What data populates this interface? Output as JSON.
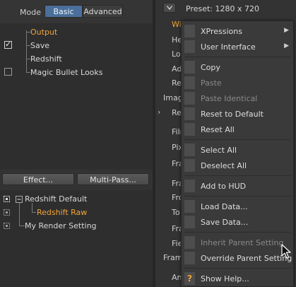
{
  "mode": {
    "label": "Mode",
    "basic": "Basic",
    "advanced": "Advanced"
  },
  "tree_top": [
    {
      "label": "Output",
      "checked": null,
      "active": true
    },
    {
      "label": "Save",
      "checked": true,
      "active": false
    },
    {
      "label": "Redshift",
      "checked": null,
      "active": false
    },
    {
      "label": "Magic Bullet Looks",
      "checked": false,
      "active": false
    }
  ],
  "buttons": {
    "effect": "Effect...",
    "multipass": "Multi-Pass..."
  },
  "tree_bottom": [
    {
      "label": "Redshift Default",
      "active": false
    },
    {
      "label": "Redshift Raw",
      "active": true
    },
    {
      "label": "My Render Setting",
      "active": false
    }
  ],
  "right": {
    "preset": "Preset: 1280 x 720",
    "params": [
      "Wi",
      "He",
      "Lo",
      "Ad",
      "Res",
      "Image",
      "Re",
      "Film",
      "Pix",
      "Fra",
      "Fra",
      "Fro",
      "To",
      "Fra",
      "Fie",
      "Frame",
      "An"
    ]
  },
  "menu": {
    "items": [
      {
        "label": "XPressions",
        "submenu": true,
        "disabled": false
      },
      {
        "label": "User Interface",
        "submenu": true,
        "disabled": false
      },
      {
        "sep": true
      },
      {
        "label": "Copy",
        "disabled": false
      },
      {
        "label": "Paste",
        "disabled": true
      },
      {
        "label": "Paste Identical",
        "disabled": true
      },
      {
        "label": "Reset to Default",
        "disabled": false
      },
      {
        "label": "Reset All",
        "disabled": false
      },
      {
        "sep": true
      },
      {
        "label": "Select All",
        "disabled": false
      },
      {
        "label": "Deselect All",
        "disabled": false
      },
      {
        "sep": true
      },
      {
        "label": "Add to HUD",
        "disabled": false
      },
      {
        "sep": true
      },
      {
        "label": "Load Data...",
        "disabled": false
      },
      {
        "label": "Save Data...",
        "disabled": false
      },
      {
        "sep": true
      },
      {
        "label": "Inherit Parent Setting",
        "disabled": true
      },
      {
        "label": "Override Parent Setting",
        "disabled": false
      },
      {
        "sep": true
      },
      {
        "label": "Show Help...",
        "disabled": false,
        "icon": "help-icon"
      }
    ],
    "help_glyph": "?"
  },
  "colors": {
    "accent": "#4a6f9a",
    "active_text": "#f2a43a"
  }
}
